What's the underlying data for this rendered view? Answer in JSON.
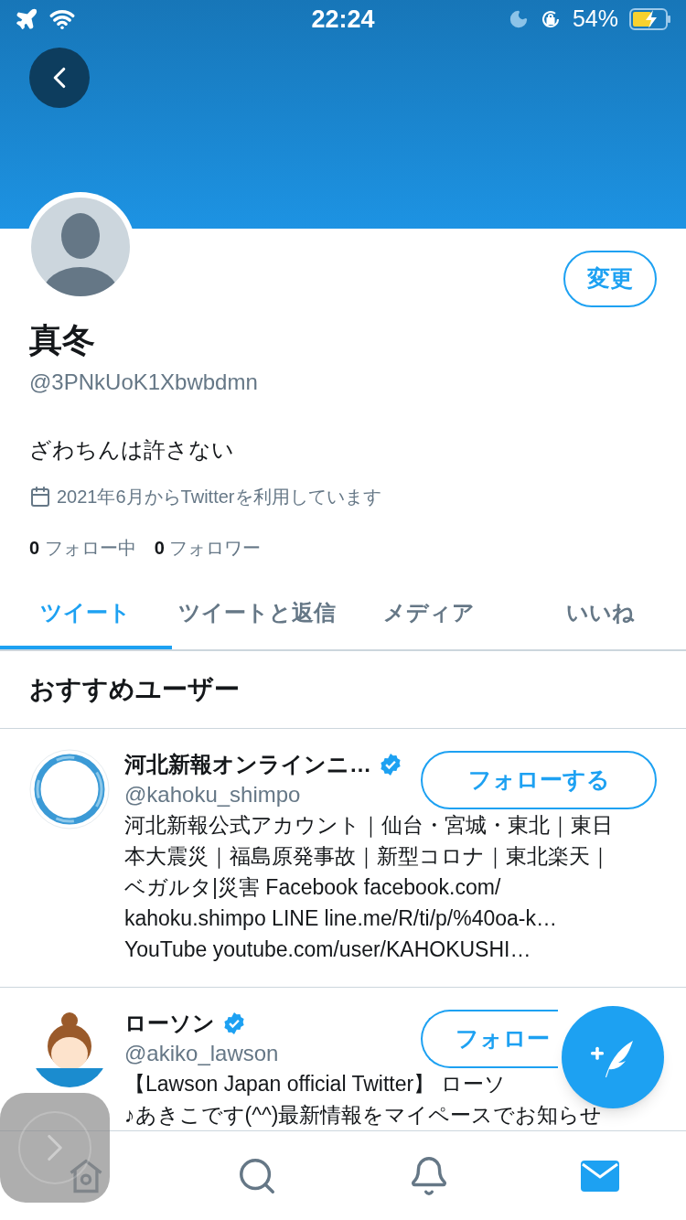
{
  "status_bar": {
    "time": "22:24",
    "battery": "54%"
  },
  "profile": {
    "edit_button": "変更",
    "name": "真冬",
    "handle": "@3PNkUoK1Xbwbdmn",
    "bio": "ざわちんは許さない",
    "joined": "2021年6月からTwitterを利用しています",
    "following_count": "0",
    "following_label": "フォロー中",
    "followers_count": "0",
    "followers_label": "フォロワー"
  },
  "tabs": [
    {
      "label": "ツイート",
      "selected": true
    },
    {
      "label": "ツイートと返信",
      "selected": false
    },
    {
      "label": "メディア",
      "selected": false
    },
    {
      "label": "いいね",
      "selected": false
    }
  ],
  "suggestions": {
    "title": "おすすめユーザー",
    "users": [
      {
        "kind": "ring",
        "name": "河北新報オンラインニ…",
        "verified": true,
        "handle": "@kahoku_shimpo",
        "follow_button": "フォローする",
        "bio_lines": [
          "河北新報公式アカウント｜仙台・宮城・東北｜東日",
          "本大震災｜福島原発事故｜新型コロナ｜東北楽天｜",
          "ベガルタ|災害 Facebook facebook.com/",
          "kahoku.shimpo LINE line.me/R/ti/p/%40oa-k…",
          "YouTube youtube.com/user/KAHOKUSHI…"
        ]
      },
      {
        "kind": "figure",
        "name": "ローソン",
        "verified": true,
        "handle": "@akiko_lawson",
        "follow_button": "フォロー",
        "bio_lines": [
          "【Lawson Japan official Twitter】 ローソ",
          "♪あきこです(^^)最新情報をマイペースでお知らせ"
        ]
      }
    ]
  },
  "bottom_nav": [
    {
      "kind": "home",
      "selected": false
    },
    {
      "kind": "search",
      "selected": false
    },
    {
      "kind": "notifications",
      "selected": false
    },
    {
      "kind": "messages",
      "selected": true
    }
  ]
}
